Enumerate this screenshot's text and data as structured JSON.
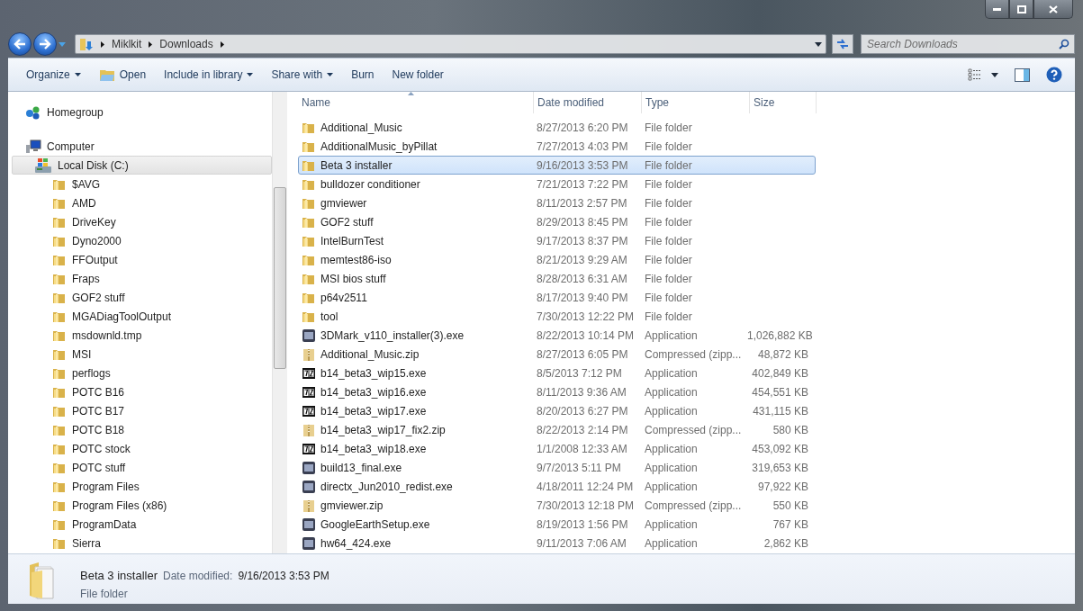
{
  "window": {
    "controls": [
      {
        "kind": "minimize"
      },
      {
        "kind": "maximize"
      },
      {
        "kind": "close"
      }
    ]
  },
  "address": {
    "crumbs": [
      "Miklkit",
      "Downloads"
    ]
  },
  "search": {
    "placeholder": "Search Downloads"
  },
  "toolbar": {
    "buttons": [
      {
        "label": "Organize",
        "dropdown": true,
        "icon": false
      },
      {
        "label": "Open",
        "dropdown": false,
        "icon": true
      },
      {
        "label": "Include in library",
        "dropdown": true,
        "icon": false
      },
      {
        "label": "Share with",
        "dropdown": true,
        "icon": false
      },
      {
        "label": "Burn",
        "dropdown": false,
        "icon": false
      },
      {
        "label": "New folder",
        "dropdown": false,
        "icon": false
      }
    ]
  },
  "sidebar": {
    "items": [
      {
        "label": "Homegroup",
        "kind": "homegroup",
        "selected": false
      },
      {
        "label": "Computer",
        "kind": "computer",
        "selected": false,
        "children": [
          {
            "label": "Local Disk (C:)",
            "kind": "drive",
            "selected": true,
            "children": [
              {
                "label": "$AVG",
                "kind": "folder",
                "selected": false
              },
              {
                "label": "AMD",
                "kind": "folder",
                "selected": false
              },
              {
                "label": "DriveKey",
                "kind": "folder",
                "selected": false
              },
              {
                "label": "Dyno2000",
                "kind": "folder",
                "selected": false
              },
              {
                "label": "FFOutput",
                "kind": "folder",
                "selected": false
              },
              {
                "label": "Fraps",
                "kind": "folder",
                "selected": false
              },
              {
                "label": "GOF2 stuff",
                "kind": "folder",
                "selected": false
              },
              {
                "label": "MGADiagToolOutput",
                "kind": "folder",
                "selected": false
              },
              {
                "label": "msdownld.tmp",
                "kind": "folder",
                "selected": false
              },
              {
                "label": "MSI",
                "kind": "folder",
                "selected": false
              },
              {
                "label": "perflogs",
                "kind": "folder",
                "selected": false
              },
              {
                "label": "POTC B16",
                "kind": "folder",
                "selected": false
              },
              {
                "label": "POTC B17",
                "kind": "folder",
                "selected": false
              },
              {
                "label": "POTC B18",
                "kind": "folder",
                "selected": false
              },
              {
                "label": "POTC stock",
                "kind": "folder",
                "selected": false
              },
              {
                "label": "POTC stuff",
                "kind": "folder",
                "selected": false
              },
              {
                "label": "Program Files",
                "kind": "folder",
                "selected": false
              },
              {
                "label": "Program Files (x86)",
                "kind": "folder",
                "selected": false
              },
              {
                "label": "ProgramData",
                "kind": "folder",
                "selected": false
              },
              {
                "label": "Sierra",
                "kind": "folder",
                "selected": false
              }
            ]
          }
        ]
      }
    ]
  },
  "table": {
    "columns": [
      "Name",
      "Date modified",
      "Type",
      "Size"
    ],
    "rows": [
      {
        "name": "Additional_Music",
        "date": "8/27/2013 6:20 PM",
        "type": "File folder",
        "kind": "folder",
        "selected": false
      },
      {
        "name": "AdditionalMusic_byPillat",
        "date": "7/27/2013 4:03 PM",
        "type": "File folder",
        "kind": "folder",
        "selected": false
      },
      {
        "name": "Beta 3 installer",
        "date": "9/16/2013 3:53 PM",
        "type": "File folder",
        "kind": "folder",
        "selected": true
      },
      {
        "name": "bulldozer conditioner",
        "date": "7/21/2013 7:22 PM",
        "type": "File folder",
        "kind": "folder",
        "selected": false
      },
      {
        "name": "gmviewer",
        "date": "8/11/2013 2:57 PM",
        "type": "File folder",
        "kind": "folder",
        "selected": false
      },
      {
        "name": "GOF2 stuff",
        "date": "8/29/2013 8:45 PM",
        "type": "File folder",
        "kind": "folder",
        "selected": false
      },
      {
        "name": "IntelBurnTest",
        "date": "9/17/2013 8:37 PM",
        "type": "File folder",
        "kind": "folder",
        "selected": false
      },
      {
        "name": "memtest86-iso",
        "date": "8/21/2013 9:29 AM",
        "type": "File folder",
        "kind": "folder",
        "selected": false
      },
      {
        "name": "MSI bios stuff",
        "date": "8/28/2013 6:31 AM",
        "type": "File folder",
        "kind": "folder",
        "selected": false
      },
      {
        "name": "p64v2511",
        "date": "8/17/2013 9:40 PM",
        "type": "File folder",
        "kind": "folder",
        "selected": false
      },
      {
        "name": "tool",
        "date": "7/30/2013 12:22 PM",
        "type": "File folder",
        "kind": "folder",
        "selected": false
      },
      {
        "name": "3DMark_v110_installer(3).exe",
        "date": "8/22/2013 10:14 PM",
        "type": "Application",
        "size": "1,026,882 KB",
        "kind": "app",
        "selected": false
      },
      {
        "name": "Additional_Music.zip",
        "date": "8/27/2013 6:05 PM",
        "type": "Compressed (zipp...",
        "size": "48,872 KB",
        "kind": "zip",
        "selected": false
      },
      {
        "name": "b14_beta3_wip15.exe",
        "date": "8/5/2013 7:12 PM",
        "type": "Application",
        "size": "402,849 KB",
        "kind": "sevenzip",
        "selected": false
      },
      {
        "name": "b14_beta3_wip16.exe",
        "date": "8/11/2013 9:36 AM",
        "type": "Application",
        "size": "454,551 KB",
        "kind": "sevenzip",
        "selected": false
      },
      {
        "name": "b14_beta3_wip17.exe",
        "date": "8/20/2013 6:27 PM",
        "type": "Application",
        "size": "431,115 KB",
        "kind": "sevenzip",
        "selected": false
      },
      {
        "name": "b14_beta3_wip17_fix2.zip",
        "date": "8/22/2013 2:14 PM",
        "type": "Compressed (zipp...",
        "size": "580 KB",
        "kind": "zip",
        "selected": false
      },
      {
        "name": "b14_beta3_wip18.exe",
        "date": "1/1/2008 12:33 AM",
        "type": "Application",
        "size": "453,092 KB",
        "kind": "sevenzip",
        "selected": false
      },
      {
        "name": "build13_final.exe",
        "date": "9/7/2013 5:11 PM",
        "type": "Application",
        "size": "319,653 KB",
        "kind": "app",
        "selected": false
      },
      {
        "name": "directx_Jun2010_redist.exe",
        "date": "4/18/2011 12:24 PM",
        "type": "Application",
        "size": "97,922 KB",
        "kind": "app",
        "selected": false
      },
      {
        "name": "gmviewer.zip",
        "date": "7/30/2013 12:18 PM",
        "type": "Compressed (zipp...",
        "size": "550 KB",
        "kind": "zip",
        "selected": false
      },
      {
        "name": "GoogleEarthSetup.exe",
        "date": "8/19/2013 1:56 PM",
        "type": "Application",
        "size": "767 KB",
        "kind": "app",
        "selected": false
      },
      {
        "name": "hw64_424.exe",
        "date": "9/11/2013 7:06 AM",
        "type": "Application",
        "size": "2,862 KB",
        "kind": "app",
        "selected": false
      }
    ]
  },
  "details": {
    "name": "Beta 3 installer",
    "label": "Date modified:",
    "value": "9/16/2013 3:53 PM",
    "type": "File folder"
  }
}
